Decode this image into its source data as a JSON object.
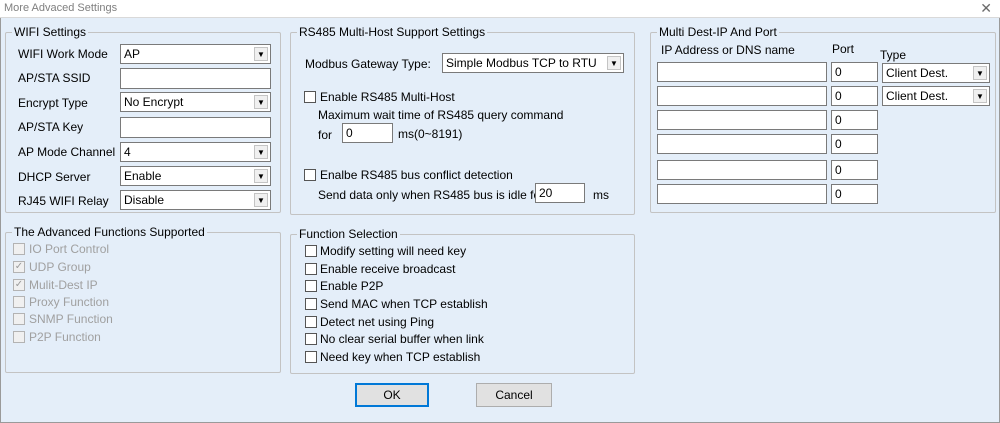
{
  "window": {
    "title": "More Advaced Settings"
  },
  "wifi": {
    "legend": "WIFI Settings",
    "work_mode_label": "WIFI Work Mode",
    "work_mode_value": "AP",
    "ssid_label": "AP/STA SSID",
    "ssid_value": "",
    "encrypt_label": "Encrypt Type",
    "encrypt_value": "No Encrypt",
    "key_label": "AP/STA Key",
    "key_value": "",
    "channel_label": "AP Mode Channel",
    "channel_value": "4",
    "dhcp_label": "DHCP Server",
    "dhcp_value": "Enable",
    "relay_label": "RJ45 WIFI Relay",
    "relay_value": "Disable"
  },
  "rs485": {
    "legend": "RS485 Multi-Host Support Settings",
    "gateway_label": "Modbus Gateway Type:",
    "gateway_value": "Simple Modbus TCP to RTU",
    "multihost_label": "Enable RS485 Multi-Host",
    "wait_line": "Maximum wait time of RS485  query command",
    "for_label": "for",
    "wait_value": "0",
    "wait_unit": "ms(0~8191)",
    "conflict_label": "Enalbe RS485 bus conflict detection",
    "idle_label": "Send data only when RS485 bus is idle for",
    "idle_value": "20",
    "idle_unit": "ms"
  },
  "multidest": {
    "legend": "Multi Dest-IP And Port",
    "col_ip": "IP Address or DNS name",
    "col_port": "Port",
    "col_type": "Type",
    "rows": [
      {
        "ip": "",
        "port": "0",
        "type": "Client Dest."
      },
      {
        "ip": "",
        "port": "0",
        "type": "Client Dest."
      },
      {
        "ip": "",
        "port": "0"
      },
      {
        "ip": "",
        "port": "0"
      },
      {
        "ip": "",
        "port": "0"
      },
      {
        "ip": "",
        "port": "0"
      }
    ]
  },
  "advanced": {
    "legend": "The Advanced Functions Supported",
    "items": [
      {
        "label": "IO Port Control",
        "checked": false
      },
      {
        "label": "UDP Group",
        "checked": true
      },
      {
        "label": "Mulit-Dest IP",
        "checked": true
      },
      {
        "label": "Proxy Function",
        "checked": false
      },
      {
        "label": "SNMP Function",
        "checked": false
      },
      {
        "label": "P2P Function",
        "checked": false
      }
    ]
  },
  "functions": {
    "legend": "Function Selection",
    "items": [
      {
        "label": "Modify setting will need key"
      },
      {
        "label": "Enable receive broadcast"
      },
      {
        "label": "Enable P2P"
      },
      {
        "label": "Send MAC when TCP establish"
      },
      {
        "label": "Detect net using Ping"
      },
      {
        "label": "No clear serial buffer when link"
      },
      {
        "label": "Need key when TCP establish"
      }
    ]
  },
  "buttons": {
    "ok": "OK",
    "cancel": "Cancel"
  }
}
